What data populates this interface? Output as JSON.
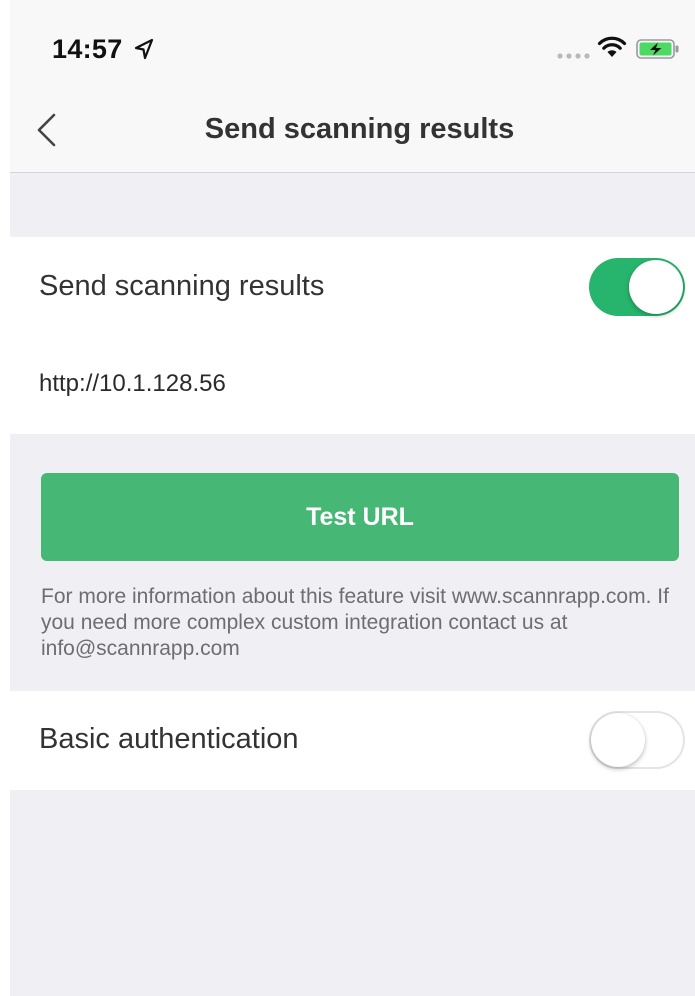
{
  "status_bar": {
    "time": "14:57",
    "icons": [
      "location-arrow-icon",
      "signal-dots-icon",
      "wifi-icon",
      "battery-charging-icon"
    ],
    "battery_color": "#4cd964"
  },
  "nav": {
    "back_icon": "chevron-left-icon",
    "title": "Send scanning results"
  },
  "send_section": {
    "label": "Send scanning results",
    "toggle_on": true,
    "url": "http://10.1.128.56"
  },
  "test_button": {
    "label": "Test URL",
    "color": "#47b775"
  },
  "footnote": "For more information about this feature visit www.scannrapp.com. If you need more complex custom integration contact us at info@scannrapp.com",
  "auth_section": {
    "label": "Basic authentication",
    "toggle_on": false
  },
  "colors": {
    "accent_green": "#27b46d",
    "background": "#efeff4"
  }
}
